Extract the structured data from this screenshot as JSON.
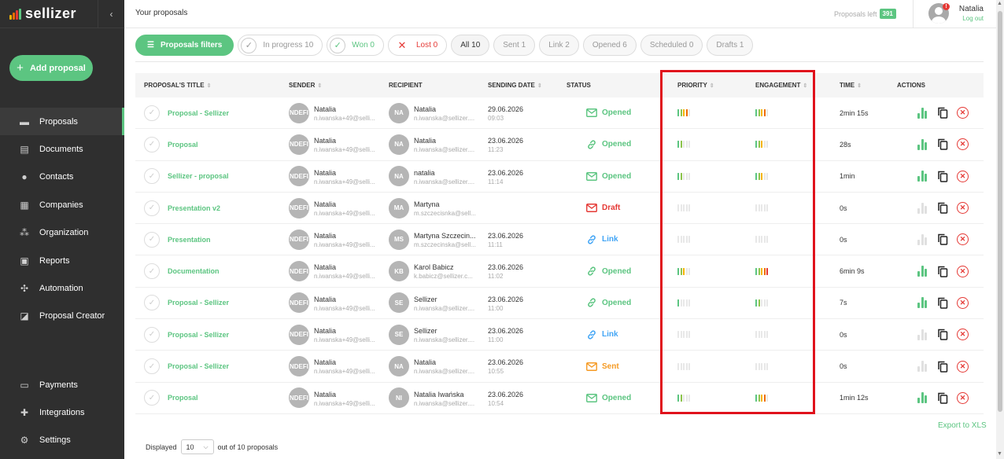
{
  "app": {
    "logo_text": "sellizer",
    "logo_bar_colors": [
      "#f4b400",
      "#ef6c00",
      "#e53935",
      "#5cc581"
    ],
    "accent_color": "#5cc581",
    "danger_color": "#e53935"
  },
  "sidebar": {
    "add_button": "Add proposal",
    "collapse_icon": "‹",
    "items": [
      {
        "label": "Proposals",
        "icon": "folder-icon",
        "glyph": "▬"
      },
      {
        "label": "Documents",
        "icon": "document-icon",
        "glyph": "▤"
      },
      {
        "label": "Contacts",
        "icon": "person-icon",
        "glyph": "●"
      },
      {
        "label": "Companies",
        "icon": "building-icon",
        "glyph": "▦"
      },
      {
        "label": "Organization",
        "icon": "team-icon",
        "glyph": "⁂"
      },
      {
        "label": "Reports",
        "icon": "report-icon",
        "glyph": "▣"
      },
      {
        "label": "Automation",
        "icon": "automation-icon",
        "glyph": "✣"
      },
      {
        "label": "Proposal Creator",
        "icon": "creator-icon",
        "glyph": "◪"
      }
    ],
    "bottom_items": [
      {
        "label": "Payments",
        "icon": "card-icon",
        "glyph": "▭"
      },
      {
        "label": "Integrations",
        "icon": "puzzle-icon",
        "glyph": "✚"
      },
      {
        "label": "Settings",
        "icon": "gear-icon",
        "glyph": "⚙"
      }
    ]
  },
  "header": {
    "title": "Your proposals",
    "proposals_left_label": "Proposals left",
    "proposals_left_value": "391",
    "notification_count": "!",
    "user_name": "Natalia",
    "logout_label": "Log out"
  },
  "filters": {
    "button": "Proposals filters",
    "pills": [
      {
        "label": "In progress 10",
        "kind": "progress"
      },
      {
        "label": "Won 0",
        "kind": "won"
      },
      {
        "label": "Lost 0",
        "kind": "lost"
      },
      {
        "label": "All 10",
        "kind": "all"
      },
      {
        "label": "Sent 1",
        "kind": "gray"
      },
      {
        "label": "Link 2",
        "kind": "gray"
      },
      {
        "label": "Opened 6",
        "kind": "gray"
      },
      {
        "label": "Scheduled 0",
        "kind": "gray"
      },
      {
        "label": "Drafts 1",
        "kind": "gray"
      }
    ]
  },
  "table": {
    "headers": {
      "title": "PROPOSAL'S TITLE",
      "sender": "SENDER",
      "recipient": "RECIPIENT",
      "date": "SENDING DATE",
      "status": "STATUS",
      "priority": "PRIORITY",
      "engagement": "ENGAGEMENT",
      "time": "TIME",
      "actions": "ACTIONS"
    },
    "rows": [
      {
        "title": "Proposal - Sellizer",
        "sender_initials": "NDEFI",
        "sender_name": "Natalia",
        "sender_email": "n.iwanska+49@selli...",
        "recipient_initials": "NA",
        "recipient_name": "Natalia",
        "recipient_email": "n.iwanska@sellizer....",
        "date": "29.06.2026",
        "time_of_day": "09:03",
        "status": "Opened",
        "status_kind": "opened",
        "priority": 4,
        "engagement": 4,
        "time": "2min 15s",
        "active": true
      },
      {
        "title": "Proposal",
        "sender_initials": "NDEFI",
        "sender_name": "Natalia",
        "sender_email": "n.iwanska+49@selli...",
        "recipient_initials": "NA",
        "recipient_name": "Natalia",
        "recipient_email": "n.iwanska@sellizer....",
        "date": "23.06.2026",
        "time_of_day": "11:23",
        "status": "Opened",
        "status_kind": "link-opened",
        "priority": 2,
        "engagement": 3,
        "time": "28s",
        "active": true
      },
      {
        "title": "Sellizer - proposal",
        "sender_initials": "NDEFI",
        "sender_name": "Natalia",
        "sender_email": "n.iwanska+49@selli...",
        "recipient_initials": "NA",
        "recipient_name": "natalia",
        "recipient_email": "n.iwanska@sellizer....",
        "date": "23.06.2026",
        "time_of_day": "11:14",
        "status": "Opened",
        "status_kind": "opened",
        "priority": 2,
        "engagement": 3,
        "time": "1min",
        "active": true
      },
      {
        "title": "Presentation v2",
        "sender_initials": "NDEFI",
        "sender_name": "Natalia",
        "sender_email": "n.iwanska+49@selli...",
        "recipient_initials": "MA",
        "recipient_name": "Martyna",
        "recipient_email": "m.szczecisnka@sell...",
        "date": "",
        "time_of_day": "",
        "status": "Draft",
        "status_kind": "draft",
        "priority": 0,
        "engagement": 0,
        "time": "0s",
        "active": false
      },
      {
        "title": "Presentation",
        "sender_initials": "NDEFI",
        "sender_name": "Natalia",
        "sender_email": "n.iwanska+49@selli...",
        "recipient_initials": "MS",
        "recipient_name": "Martyna Szczecin...",
        "recipient_email": "m.szczecinska@sell...",
        "date": "23.06.2026",
        "time_of_day": "11:11",
        "status": "Link",
        "status_kind": "link",
        "priority": 0,
        "engagement": 0,
        "time": "0s",
        "active": false
      },
      {
        "title": "Documentation",
        "sender_initials": "NDEFI",
        "sender_name": "Natalia",
        "sender_email": "n.iwanska+49@selli...",
        "recipient_initials": "KB",
        "recipient_name": "Karol Babicz",
        "recipient_email": "k.babicz@sellizer.c...",
        "date": "23.06.2026",
        "time_of_day": "11:02",
        "status": "Opened",
        "status_kind": "link-opened",
        "priority": 3,
        "engagement": 5,
        "time": "6min 9s",
        "active": true
      },
      {
        "title": "Proposal - Sellizer",
        "sender_initials": "NDEFI",
        "sender_name": "Natalia",
        "sender_email": "n.iwanska+49@selli...",
        "recipient_initials": "SE",
        "recipient_name": "Sellizer",
        "recipient_email": "n.iwanska@sellizer....",
        "date": "23.06.2026",
        "time_of_day": "11:00",
        "status": "Opened",
        "status_kind": "link-opened",
        "priority": 1,
        "engagement": 2,
        "time": "7s",
        "active": true
      },
      {
        "title": "Proposal - Sellizer",
        "sender_initials": "NDEFI",
        "sender_name": "Natalia",
        "sender_email": "n.iwanska+49@selli...",
        "recipient_initials": "SE",
        "recipient_name": "Sellizer",
        "recipient_email": "n.iwanska@sellizer....",
        "date": "23.06.2026",
        "time_of_day": "11:00",
        "status": "Link",
        "status_kind": "link",
        "priority": 0,
        "engagement": 0,
        "time": "0s",
        "active": false
      },
      {
        "title": "Proposal - Sellizer",
        "sender_initials": "NDEFI",
        "sender_name": "Natalia",
        "sender_email": "n.iwanska+49@selli...",
        "recipient_initials": "NA",
        "recipient_name": "Natalia",
        "recipient_email": "n.iwanska@sellizer....",
        "date": "23.06.2026",
        "time_of_day": "10:55",
        "status": "Sent",
        "status_kind": "sent",
        "priority": 0,
        "engagement": 0,
        "time": "0s",
        "active": false
      },
      {
        "title": "Proposal",
        "sender_initials": "NDEFI",
        "sender_name": "Natalia",
        "sender_email": "n.iwanska+49@selli...",
        "recipient_initials": "NI",
        "recipient_name": "Natalia Iwańska",
        "recipient_email": "n.iwanska@sellizer....",
        "date": "23.06.2026",
        "time_of_day": "10:54",
        "status": "Opened",
        "status_kind": "opened",
        "priority": 2,
        "engagement": 4,
        "time": "1min 12s",
        "active": true
      }
    ]
  },
  "status_colors": {
    "opened": "#5cc581",
    "link-opened": "#5cc581",
    "link": "#42a5f5",
    "draft": "#e53935",
    "sent": "#f59a23"
  },
  "level_colors": [
    "#5cc581",
    "#8bc34a",
    "#f4b400",
    "#ef6c00",
    "#e53935"
  ],
  "empty_level_color": "#e8e8e8",
  "export_label": "Export to XLS",
  "footer": {
    "displayed_label": "Displayed",
    "page_size": "10",
    "out_of_label": "out of 10 proposals"
  }
}
